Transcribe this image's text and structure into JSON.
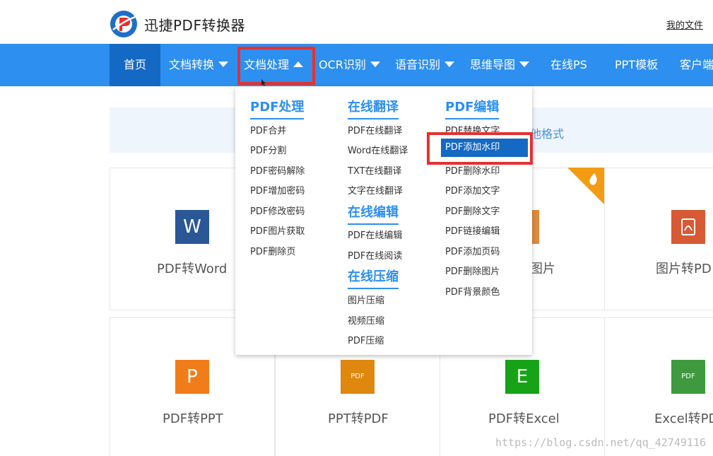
{
  "header": {
    "brand": "迅捷PDF转换器",
    "my_files": "我的文件"
  },
  "nav": {
    "items": [
      {
        "label": "首页"
      },
      {
        "label": "文档转换"
      },
      {
        "label": "文档处理"
      },
      {
        "label": "OCR识别"
      },
      {
        "label": "语音识别"
      },
      {
        "label": "思维导图"
      },
      {
        "label": "在线PS"
      },
      {
        "label": "PPT模板"
      },
      {
        "label": "客户端"
      }
    ]
  },
  "dropdown": {
    "col1": {
      "title": "PDF处理",
      "items": [
        "PDF合并",
        "PDF分割",
        "PDF密码解除",
        "PDF增加密码",
        "PDF修改密码",
        "PDF图片获取",
        "PDF删除页"
      ]
    },
    "col2": {
      "title1": "在线翻译",
      "items1": [
        "PDF在线翻译",
        "Word在线翻译",
        "TXT在线翻译",
        "文字在线翻译"
      ],
      "title2": "在线编辑",
      "items2": [
        "PDF在线编辑",
        "PDF在线阅读"
      ],
      "title3": "在线压缩",
      "items3": [
        "图片压缩",
        "视频压缩",
        "PDF压缩"
      ]
    },
    "col3": {
      "title": "PDF编辑",
      "items": [
        "PDF替换文字",
        "PDF添加水印",
        "PDF删除水印",
        "PDF添加文字",
        "PDF删除文字",
        "PDF链接编辑",
        "PDF添加页码",
        "PDF删除图片",
        "PDF背景颜色"
      ]
    }
  },
  "banner": {
    "text_fragment": "他格式"
  },
  "cards": [
    {
      "label": "PDF转Word",
      "icon": "W"
    },
    {
      "label": "图片",
      "icon": ""
    },
    {
      "label": "图片转PD",
      "icon": "pdf-icon"
    },
    {
      "label": "PDF转PPT",
      "icon": "P"
    },
    {
      "label": "PPT转PDF",
      "icon": "PDF"
    },
    {
      "label": "PDF转Excel",
      "icon": "E"
    },
    {
      "label": "Excel转PD",
      "icon": "PDF"
    }
  ],
  "colors": {
    "nav_blue": "#2d8ff0",
    "nav_active": "#1469c4",
    "highlight_red": "#e5312f",
    "word_blue": "#2b5797",
    "ppt_orange": "#f07c1a",
    "excel_green": "#17a317",
    "pdf_red": "#d75a34"
  },
  "watermark": "https://blog.csdn.net/qq_42749116"
}
